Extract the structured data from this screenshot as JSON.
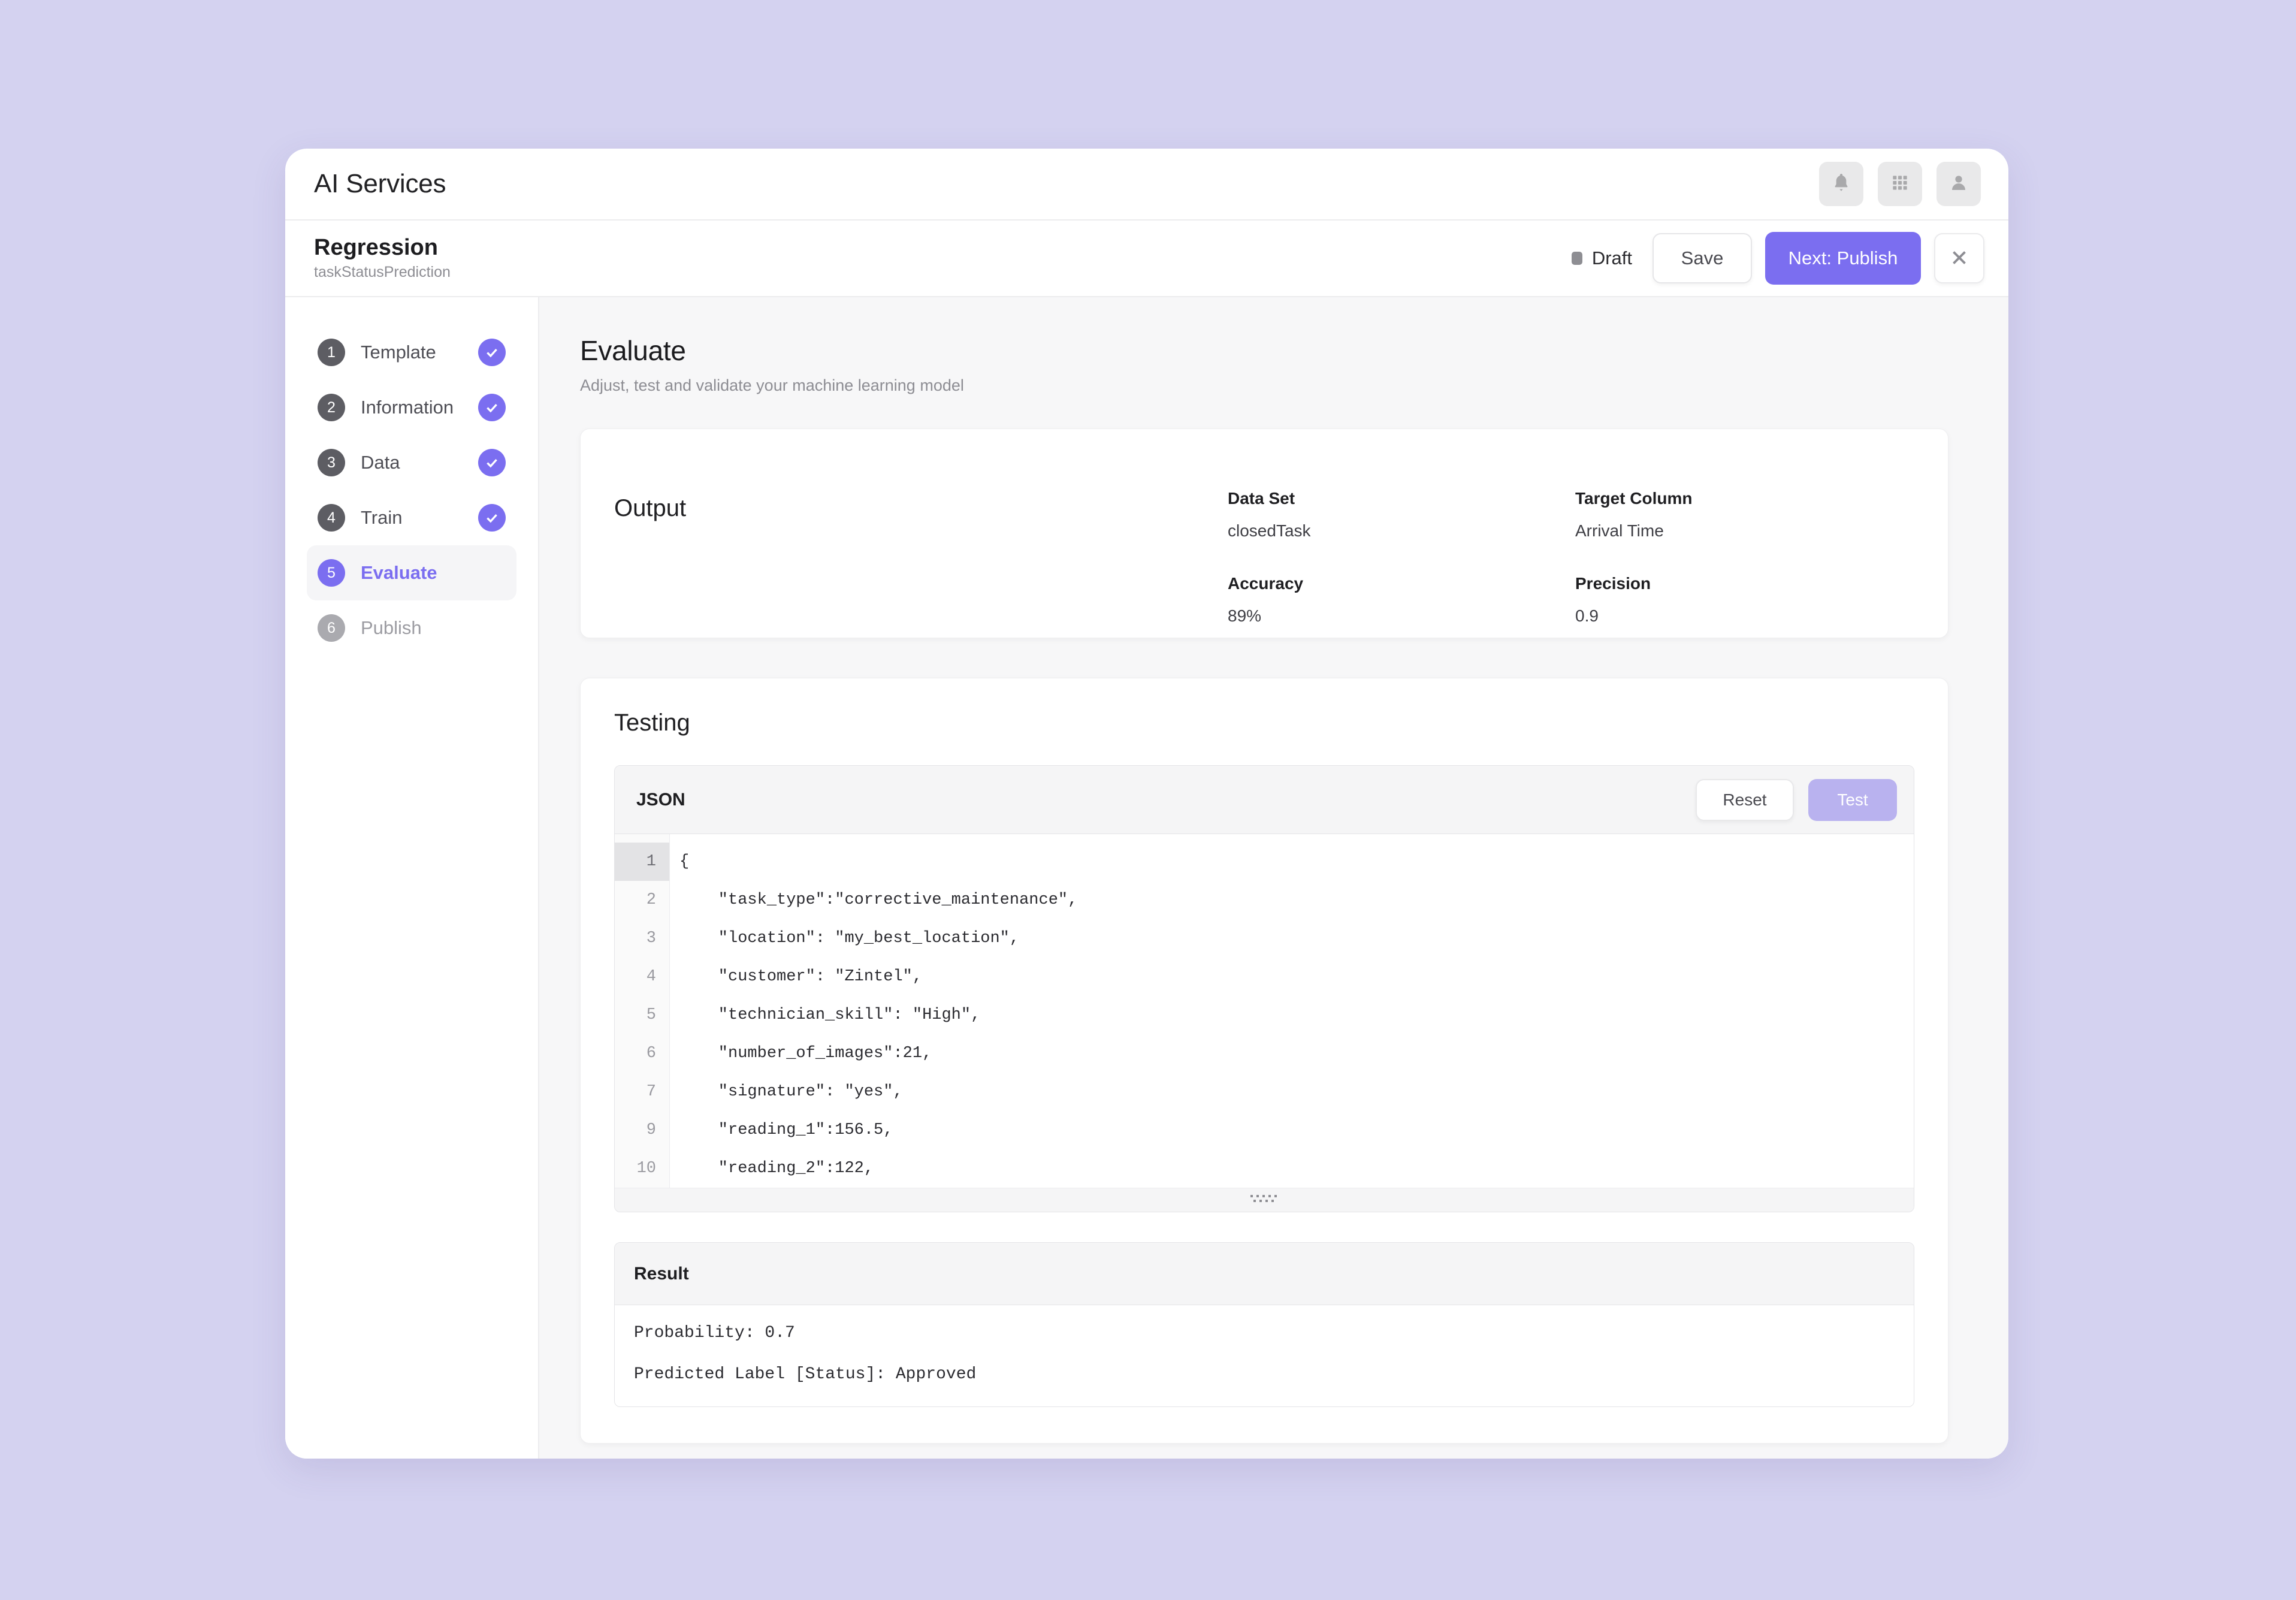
{
  "app": {
    "title": "AI Services",
    "topbar_icons": [
      {
        "name": "bell-icon",
        "label": "Notifications"
      },
      {
        "name": "grid-apps-icon",
        "label": "Apps"
      },
      {
        "name": "user-account-icon",
        "label": "Account"
      }
    ]
  },
  "subheader": {
    "title": "Regression",
    "subtitle": "taskStatusPrediction",
    "status": "Draft",
    "save_label": "Save",
    "next_label": "Next: Publish",
    "close_label": "Close"
  },
  "sidebar": {
    "steps": [
      {
        "num": "1",
        "label": "Template",
        "state": "done"
      },
      {
        "num": "2",
        "label": "Information",
        "state": "done"
      },
      {
        "num": "3",
        "label": "Data",
        "state": "done"
      },
      {
        "num": "4",
        "label": "Train",
        "state": "done"
      },
      {
        "num": "5",
        "label": "Evaluate",
        "state": "active"
      },
      {
        "num": "6",
        "label": "Publish",
        "state": "pending"
      }
    ]
  },
  "main": {
    "title": "Evaluate",
    "subtitle": "Adjust, test and validate your machine learning model",
    "output": {
      "label": "Output",
      "fields": [
        {
          "key": "Data Set",
          "value": "closedTask"
        },
        {
          "key": "Target Column",
          "value": "Arrival Time"
        },
        {
          "key": "Accuracy",
          "value": "89%"
        },
        {
          "key": "Precision",
          "value": "0.9"
        }
      ]
    },
    "testing": {
      "title": "Testing",
      "editor": {
        "label": "JSON",
        "reset_label": "Reset",
        "test_label": "Test",
        "lines": [
          {
            "num": "1",
            "text": "{",
            "current": true
          },
          {
            "num": "2",
            "text": "    \"task_type\":\"corrective_maintenance\",",
            "current": false
          },
          {
            "num": "3",
            "text": "    \"location\": \"my_best_location\",",
            "current": false
          },
          {
            "num": "4",
            "text": "    \"customer\": \"Zintel\",",
            "current": false
          },
          {
            "num": "5",
            "text": "    \"technician_skill\": \"High\",",
            "current": false
          },
          {
            "num": "6",
            "text": "    \"number_of_images\":21,",
            "current": false
          },
          {
            "num": "7",
            "text": "    \"signature\": \"yes\",",
            "current": false
          },
          {
            "num": "9",
            "text": "    \"reading_1\":156.5,",
            "current": false
          },
          {
            "num": "10",
            "text": "    \"reading_2\":122,",
            "current": false
          }
        ]
      },
      "result": {
        "label": "Result",
        "lines": [
          "Probability: 0.7",
          "Predicted Label [Status]: Approved"
        ]
      }
    }
  },
  "colors": {
    "page_bg": "#d4d2f0",
    "accent": "#7b6ef0",
    "accent_muted": "#b9b2ef",
    "content_bg": "#f7f7f8"
  }
}
